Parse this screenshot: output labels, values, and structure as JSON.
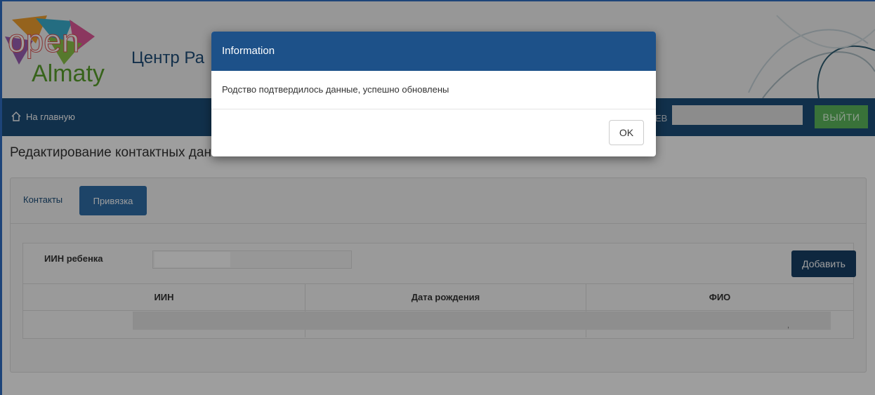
{
  "header": {
    "logo_top": "open",
    "logo_bottom": "Almaty",
    "site_title": "Центр Ра"
  },
  "navbar": {
    "home_label": "На главную",
    "user_prefix": "ЕВ",
    "logout_label": "ВЫЙТИ"
  },
  "main": {
    "page_title": "Редактирование контактных дан",
    "tabs": [
      {
        "label": "Контакты"
      },
      {
        "label": "Привязка"
      }
    ],
    "iin_label": "ИИН ребенка",
    "add_label": "Добавить",
    "table": {
      "headers": [
        "ИИН",
        "Дата рождения",
        "ФИО"
      ],
      "trailing_mark": ","
    }
  },
  "modal": {
    "title": "Information",
    "message": "Родство подтвердилось данные, успешно обновлены",
    "ok_label": "OK"
  },
  "colors": {
    "navbar": "#1c4e7a",
    "modal_header": "#1d5189",
    "logout": "#5cb85c",
    "add_button": "#173f66",
    "active_tab": "#2f6ea9"
  }
}
